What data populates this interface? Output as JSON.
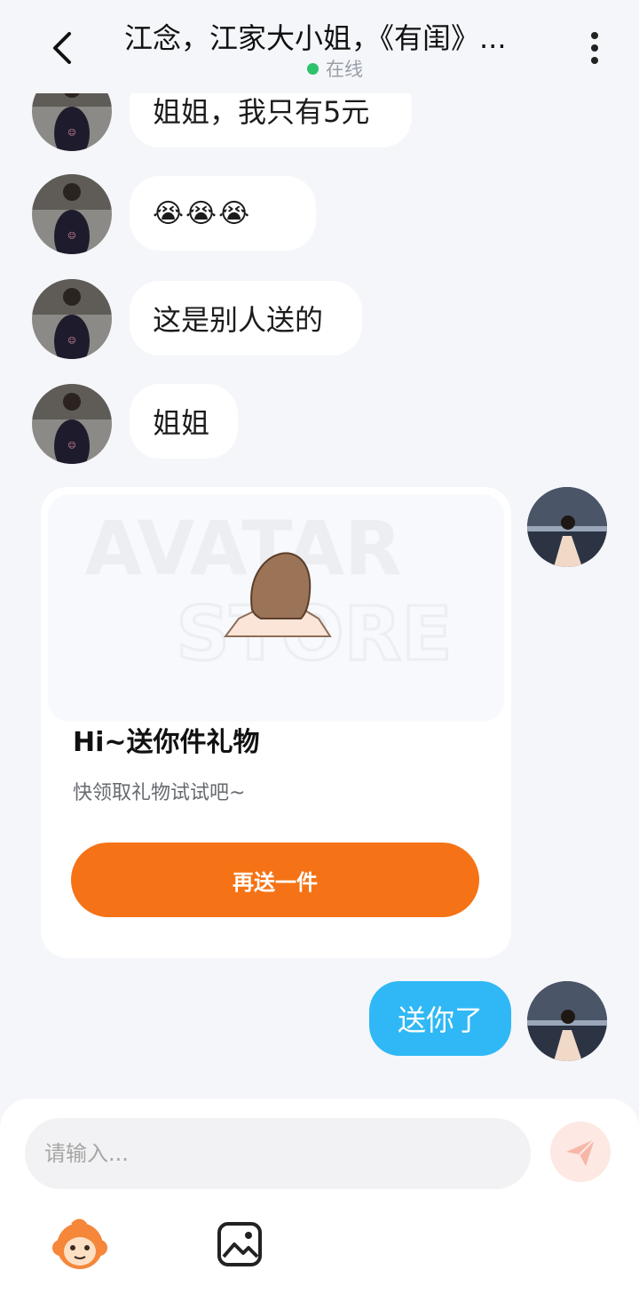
{
  "header": {
    "title": "江念，江家大小姐，《有闺》...",
    "status": "在线"
  },
  "messages": [
    {
      "text": "姐姐，我只有5元"
    },
    {
      "text": "😭😭😭"
    },
    {
      "text": "这是别人送的"
    },
    {
      "text": "姐姐"
    }
  ],
  "gift_card": {
    "watermark_top": "AVATAR",
    "watermark_bottom": "STORE",
    "title": "Hi~送你件礼物",
    "subtitle": "快领取礼物试试吧~",
    "button_label": "再送一件"
  },
  "outgoing": {
    "text": "送你了"
  },
  "composer": {
    "placeholder": "请输入..."
  },
  "colors": {
    "accent_orange": "#f57316",
    "outgoing_bubble": "#2fb8f5",
    "online_dot": "#2ec36a"
  }
}
